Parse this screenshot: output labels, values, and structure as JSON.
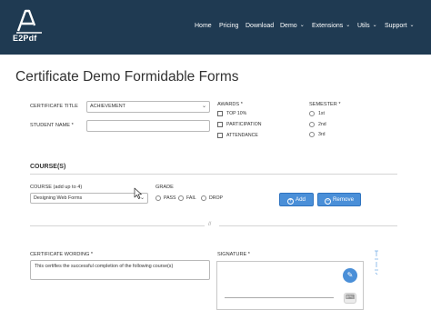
{
  "header": {
    "logo_text": "E2Pdf",
    "nav": [
      {
        "label": "Home",
        "has_dropdown": false
      },
      {
        "label": "Pricing",
        "has_dropdown": false
      },
      {
        "label": "Download",
        "has_dropdown": false
      },
      {
        "label": "Demo",
        "has_dropdown": true
      },
      {
        "label": "Extensions",
        "has_dropdown": true
      },
      {
        "label": "Utils",
        "has_dropdown": true
      },
      {
        "label": "Support",
        "has_dropdown": true
      }
    ],
    "background": "#1f3a52"
  },
  "page": {
    "title": "Certificate Demo Formidable Forms"
  },
  "form": {
    "certificate_title": {
      "label": "CERTIFICATE TITLE",
      "value": "ACHIEVEMENT"
    },
    "student_name": {
      "label": "STUDENT NAME *",
      "value": ""
    },
    "awards": {
      "label": "AWARDS *",
      "options": [
        "TOP 10%",
        "PARTICIPATION",
        "ATTENDANCE"
      ]
    },
    "semester": {
      "label": "SEMESTER *",
      "options": [
        "1st",
        "2nd",
        "3rd"
      ]
    },
    "courses": {
      "section_title": "COURSE(S)",
      "course_label": "COURSE (add up to 4)",
      "course_value": "Designing Web Forms",
      "grade_label": "GRADE",
      "grade_options": [
        "PASS",
        "FAIL",
        "DROP"
      ],
      "add_button": "Add",
      "remove_button": "Remove"
    },
    "divider_mark": "//",
    "wording": {
      "label": "CERTIFICATE WORDING *",
      "value": "This certifies the successful completion of the following course(s)"
    },
    "signature": {
      "label": "SIGNATURE *"
    }
  },
  "colors": {
    "accent": "#4a8fd8",
    "header": "#1f3a52"
  },
  "icons": {
    "pen": "pen-icon",
    "keyboard": "keyboard-icon",
    "plus": "plus-circle-icon",
    "minus": "minus-circle-icon"
  }
}
